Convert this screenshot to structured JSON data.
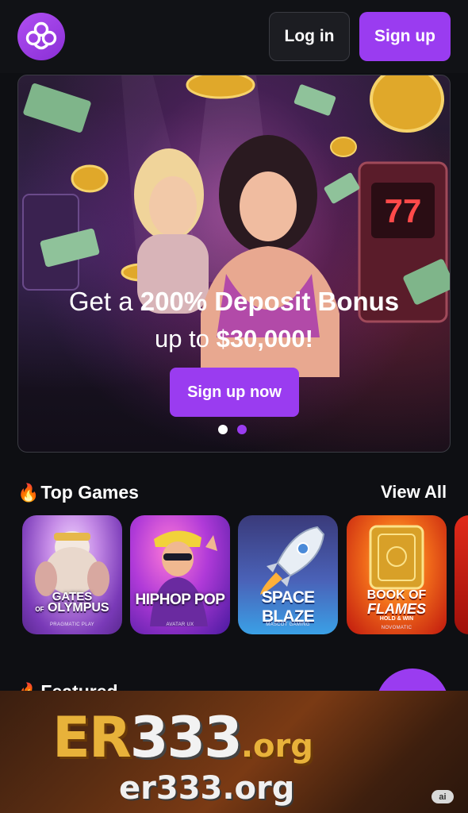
{
  "header": {
    "logo_icon": "infinity-clover-logo-icon",
    "login_label": "Log in",
    "signup_label": "Sign up"
  },
  "hero": {
    "line1_prefix": "Get a ",
    "line1_bold": "200% Deposit Bonus",
    "line2_prefix": "up to ",
    "line2_bold": "$30,000!",
    "cta_label": "Sign up now",
    "slides_total": 2,
    "active_slide": 2
  },
  "top_games": {
    "icon": "fire-icon",
    "title": "Top Games",
    "view_all_label": "View All",
    "games": [
      {
        "name_line1": "GATES",
        "name_line2": "OLYMPUS",
        "name_small": "OF",
        "provider": "PRAGMATIC PLAY"
      },
      {
        "name_line1": "HIPHOP POP",
        "provider": "AVATAR UX"
      },
      {
        "name_line1": "SPACE BLAZE",
        "provider": "MASCOT GAMING"
      },
      {
        "name_line1": "BOOK OF",
        "name_line2": "FLAMES",
        "name_small": "HOLD & WIN",
        "provider": "NOVOMATIC"
      }
    ]
  },
  "featured": {
    "icon": "fire-icon",
    "title": "Featured"
  },
  "watermark": {
    "big_prefix": "ER",
    "big_number": "333",
    "big_tld": ".org",
    "small": "er333.org",
    "badge": "ai"
  },
  "colors": {
    "accent": "#9a3cf0",
    "background": "#0e0f13",
    "header_bg": "#111216"
  }
}
